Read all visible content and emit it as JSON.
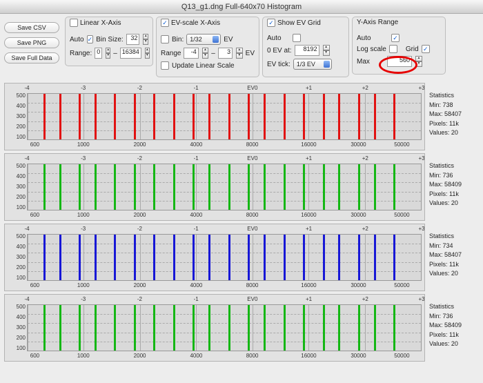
{
  "window_title": "Q13_g1.dng Full-640x70 Histogram",
  "buttons": {
    "save_csv": "Save CSV",
    "save_png": "Save PNG",
    "save_full": "Save Full Data"
  },
  "groups": {
    "linear_x": {
      "title": "Linear X-Axis",
      "checkbox_on": false,
      "auto_label": "Auto",
      "bin_label": "Bin Size:",
      "bin_checked": true,
      "bin_value": "32",
      "range_label": "Range:",
      "range_lo": "0",
      "range_hi": "16384"
    },
    "ev_x": {
      "title": "EV-scale X-Axis",
      "checkbox_on": true,
      "bin_label": "Bin:",
      "bin_value": "1/32",
      "bin_unit": "EV",
      "range_label": "Range",
      "range_lo": "-4",
      "range_hi": "3",
      "range_unit": "EV",
      "update_label": "Update Linear Scale"
    },
    "ev_grid": {
      "title": "Show EV Grid",
      "checkbox_on": true,
      "auto_label": "Auto",
      "zero_label": "0 EV at:",
      "zero_value": "8192",
      "tick_label": "EV tick:",
      "tick_value": "1/3 EV"
    },
    "y_range": {
      "title": "Y-Axis Range",
      "auto_label": "Auto",
      "auto_on": true,
      "log_label": "Log scale",
      "log_on": false,
      "grid_label": "Grid",
      "grid_on": true,
      "max_label": "Max",
      "max_value": "560"
    }
  },
  "chart_data": {
    "type": "bar",
    "ev_labels": [
      "-4",
      "-3",
      "-2",
      "-1",
      "EV0",
      "+1",
      "+2",
      "+3"
    ],
    "x_ticks": [
      "600",
      "1000",
      "2000",
      "4000",
      "8000",
      "16000",
      "30000",
      "50000"
    ],
    "x_tick_pos": [
      2,
      14.3,
      28.6,
      42.9,
      57.1,
      71.4,
      84.0,
      95.0
    ],
    "y_ticks": [
      "500",
      "400",
      "300",
      "200",
      "100"
    ],
    "bar_positions_pct": [
      4,
      8,
      13,
      17,
      22,
      27,
      32,
      37,
      42,
      46,
      51,
      56,
      60,
      65,
      70,
      75,
      79,
      84,
      88,
      93
    ],
    "panels": [
      {
        "color": "#e11111",
        "stats": {
          "title": "Statistics",
          "min": "Min: 738",
          "max": "Max: 58407",
          "pixels": "Pixels: 11k",
          "values": "Values: 20"
        }
      },
      {
        "color": "#14b714",
        "stats": {
          "title": "Statistics",
          "min": "Min: 736",
          "max": "Max: 58409",
          "pixels": "Pixels: 11k",
          "values": "Values: 20"
        }
      },
      {
        "color": "#1717d6",
        "stats": {
          "title": "Statistics",
          "min": "Min: 734",
          "max": "Max: 58407",
          "pixels": "Pixels: 11k",
          "values": "Values: 20"
        }
      },
      {
        "color": "#14b714",
        "stats": {
          "title": "Statistics",
          "min": "Min: 736",
          "max": "Max: 58409",
          "pixels": "Pixels: 11k",
          "values": "Values: 20"
        }
      }
    ]
  }
}
